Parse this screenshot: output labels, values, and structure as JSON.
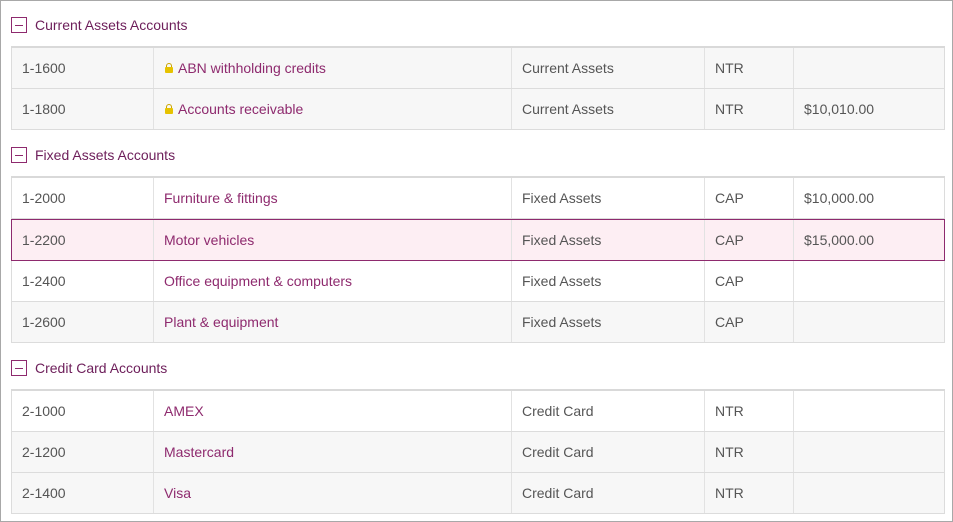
{
  "groups": [
    {
      "title": "Current Assets Accounts",
      "rows": [
        {
          "number": "1-1600",
          "name": "ABN withholding credits",
          "locked": true,
          "type": "Current Assets",
          "tax": "NTR",
          "balance": ""
        },
        {
          "number": "1-1800",
          "name": "Accounts receivable",
          "locked": true,
          "type": "Current Assets",
          "tax": "NTR",
          "balance": "$10,010.00"
        }
      ]
    },
    {
      "title": "Fixed Assets Accounts",
      "rows": [
        {
          "number": "1-2000",
          "name": "Furniture & fittings",
          "locked": false,
          "type": "Fixed Assets",
          "tax": "CAP",
          "balance": "$10,000.00"
        },
        {
          "number": "1-2200",
          "name": "Motor vehicles",
          "locked": false,
          "type": "Fixed Assets",
          "tax": "CAP",
          "balance": "$15,000.00",
          "selected": true
        },
        {
          "number": "1-2400",
          "name": "Office equipment & computers",
          "locked": false,
          "type": "Fixed Assets",
          "tax": "CAP",
          "balance": ""
        },
        {
          "number": "1-2600",
          "name": "Plant & equipment",
          "locked": false,
          "type": "Fixed Assets",
          "tax": "CAP",
          "balance": ""
        }
      ]
    },
    {
      "title": "Credit Card Accounts",
      "rows": [
        {
          "number": "2-1000",
          "name": "AMEX",
          "locked": false,
          "type": "Credit Card",
          "tax": "NTR",
          "balance": ""
        },
        {
          "number": "2-1200",
          "name": "Mastercard",
          "locked": false,
          "type": "Credit Card",
          "tax": "NTR",
          "balance": ""
        },
        {
          "number": "2-1400",
          "name": "Visa",
          "locked": false,
          "type": "Credit Card",
          "tax": "NTR",
          "balance": ""
        }
      ]
    }
  ],
  "colors": {
    "accent": "#8e2a6e",
    "selected_bg": "#fdeef3"
  },
  "icons": {
    "collapse": "minus-square-icon",
    "lock": "lock-icon"
  }
}
